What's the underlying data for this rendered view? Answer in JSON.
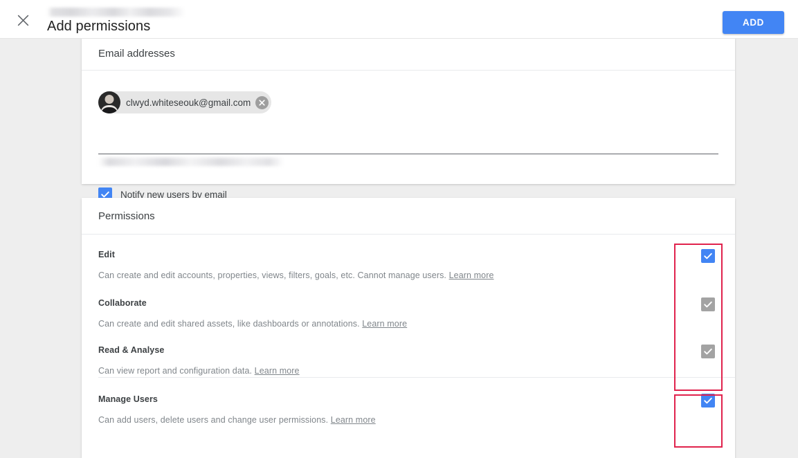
{
  "header": {
    "title": "Add permissions",
    "close_icon": "close-icon",
    "add_label": "ADD",
    "redacted_breadcrumb": "",
    "accent_color": "#4285f4"
  },
  "email_card": {
    "section_title": "Email addresses",
    "chip": {
      "email": "clwyd.whiteseouk@gmail.com",
      "avatar": "user-avatar",
      "remove_icon": "remove-chip-icon"
    },
    "redacted_helper": "",
    "notify": {
      "label": "Notify new users by email",
      "checked": true
    }
  },
  "permissions_card": {
    "section_title": "Permissions",
    "items": [
      {
        "name": "Edit",
        "description": "Can create and edit accounts, properties, views, filters, goals, etc. Cannot manage users.",
        "link_label": "Learn more",
        "checked": true,
        "state": "enabled"
      },
      {
        "name": "Collaborate",
        "description": "Can create and edit shared assets, like dashboards or annotations.",
        "link_label": "Learn more",
        "checked": true,
        "state": "disabled"
      },
      {
        "name": "Read & Analyse",
        "description": "Can view report and configuration data.",
        "link_label": "Learn more",
        "checked": true,
        "state": "disabled"
      },
      {
        "name": "Manage Users",
        "description": "Can add users, delete users and change user permissions.",
        "link_label": "Learn more",
        "checked": true,
        "state": "enabled"
      }
    ]
  },
  "annotations": {
    "color": "#e0224c",
    "boxes": [
      {
        "label": "permission-checkboxes-group"
      },
      {
        "label": "manage-users-checkbox-highlight"
      }
    ]
  }
}
